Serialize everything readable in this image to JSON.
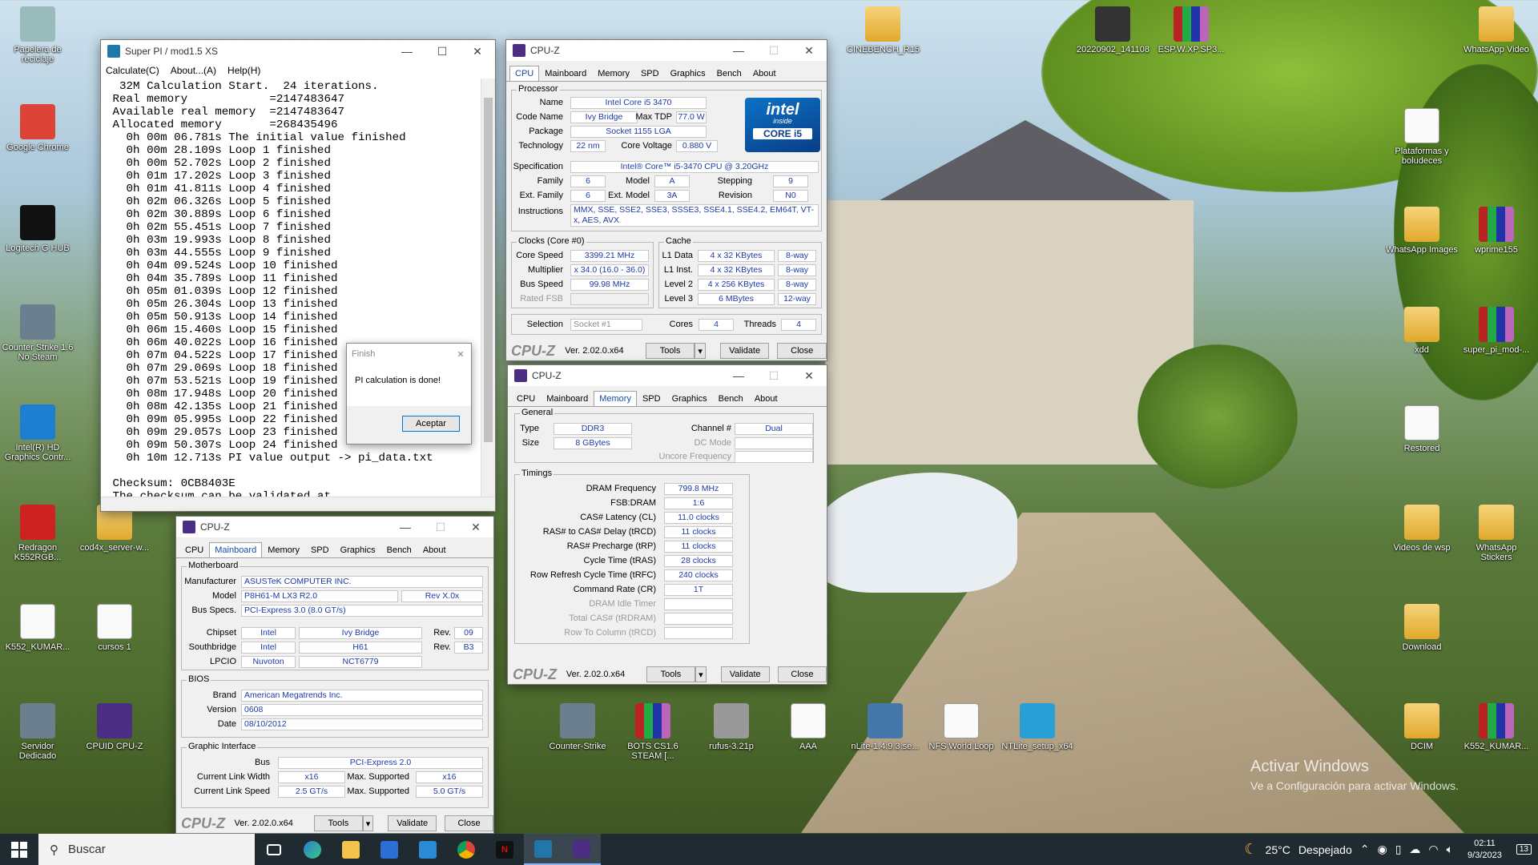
{
  "desktop": {
    "icons": [
      {
        "label": "Papelera de reciclaje",
        "kind": "app",
        "color": "#9bb"
      },
      {
        "label": "Google Chrome",
        "kind": "app",
        "color": "#db4437"
      },
      {
        "label": "Logitech G HUB",
        "kind": "app",
        "color": "#111"
      },
      {
        "label": "Counter Strike 1.6 No Steam",
        "kind": "app",
        "color": "#6b7f8e"
      },
      {
        "label": "Intel(R) HD Graphics Contr...",
        "kind": "app",
        "color": "#1e7fd0"
      },
      {
        "label": "Redragon K552RGB...",
        "kind": "app",
        "color": "#c22"
      },
      {
        "label": "K552_KUMAR...",
        "kind": "doc",
        "color": "#eee"
      },
      {
        "label": "Servidor Dedicado",
        "kind": "app",
        "color": "#6b7f8e"
      },
      {
        "label": "cod4x_server-w...",
        "kind": "folder",
        "color": ""
      },
      {
        "label": "cursos 1",
        "kind": "doc",
        "color": "#eee"
      },
      {
        "label": "CPUID CPU-Z",
        "kind": "app",
        "color": "#4b2e83"
      },
      {
        "label": "CINEBENCH_R15",
        "kind": "folder",
        "color": ""
      },
      {
        "label": "20220902_141108",
        "kind": "app",
        "color": "#333"
      },
      {
        "label": "ESP.W.XP.SP3...",
        "kind": "rar",
        "color": ""
      },
      {
        "label": "WhatsApp Video",
        "kind": "folder",
        "color": ""
      },
      {
        "label": "Plataformas y boludeces",
        "kind": "doc",
        "color": "#eee"
      },
      {
        "label": "WhatsApp Images",
        "kind": "folder",
        "color": ""
      },
      {
        "label": "wprime155",
        "kind": "rar",
        "color": ""
      },
      {
        "label": "xdd",
        "kind": "folder",
        "color": ""
      },
      {
        "label": "super_pi_mod-...",
        "kind": "rar",
        "color": ""
      },
      {
        "label": "Restored",
        "kind": "doc",
        "color": "#eee"
      },
      {
        "label": "Videos de wsp",
        "kind": "folder",
        "color": ""
      },
      {
        "label": "WhatsApp Stickers",
        "kind": "folder",
        "color": ""
      },
      {
        "label": "Download",
        "kind": "folder",
        "color": ""
      },
      {
        "label": "DCIM",
        "kind": "folder",
        "color": ""
      },
      {
        "label": "K552_KUMAR...",
        "kind": "rar",
        "color": ""
      },
      {
        "label": "Counter-Strike",
        "kind": "app",
        "color": "#6b7f8e"
      },
      {
        "label": "BOTS CS1.6 STEAM [...",
        "kind": "rar",
        "color": ""
      },
      {
        "label": "rufus-3.21p",
        "kind": "app",
        "color": "#999"
      },
      {
        "label": "AAA",
        "kind": "doc",
        "color": "#eee"
      },
      {
        "label": "nLite-1.4.9.3.se...",
        "kind": "app",
        "color": "#4477aa"
      },
      {
        "label": "NFS World Loop",
        "kind": "doc",
        "color": "#eee"
      },
      {
        "label": "NTLite_setup_x64",
        "kind": "app",
        "color": "#2a9fd6"
      }
    ],
    "watermark_title": "Activar Windows",
    "watermark_sub": "Ve a Configuración para activar Windows."
  },
  "superpi": {
    "title": "Super PI / mod1.5 XS",
    "menu": [
      "Calculate(C)",
      "About...(A)",
      "Help(H)"
    ],
    "lines": [
      "  32M Calculation Start.  24 iterations.",
      " Real memory            =2147483647",
      " Available real memory  =2147483647",
      " Allocated memory       =268435496",
      "   0h 00m 06.781s The initial value finished",
      "   0h 00m 28.109s Loop 1 finished",
      "   0h 00m 52.702s Loop 2 finished",
      "   0h 01m 17.202s Loop 3 finished",
      "   0h 01m 41.811s Loop 4 finished",
      "   0h 02m 06.326s Loop 5 finished",
      "   0h 02m 30.889s Loop 6 finished",
      "   0h 02m 55.451s Loop 7 finished",
      "   0h 03m 19.993s Loop 8 finished",
      "   0h 03m 44.555s Loop 9 finished",
      "   0h 04m 09.524s Loop 10 finished",
      "   0h 04m 35.789s Loop 11 finished",
      "   0h 05m 01.039s Loop 12 finished",
      "   0h 05m 26.304s Loop 13 finished",
      "   0h 05m 50.913s Loop 14 finished",
      "   0h 06m 15.460s Loop 15 finished",
      "   0h 06m 40.022s Loop 16 finished",
      "   0h 07m 04.522s Loop 17 finished",
      "   0h 07m 29.069s Loop 18 finished",
      "   0h 07m 53.521s Loop 19 finished",
      "   0h 08m 17.948s Loop 20 finished",
      "   0h 08m 42.135s Loop 21 finished",
      "   0h 09m 05.995s Loop 22 finished",
      "   0h 09m 29.057s Loop 23 finished",
      "   0h 09m 50.307s Loop 24 finished",
      "   0h 10m 12.713s PI value output -> pi_data.txt",
      "",
      " Checksum: 0CB8403E",
      " The checksum can be validated at"
    ]
  },
  "finish_dialog": {
    "title": "Finish",
    "message": "PI calculation is done!",
    "button": "Aceptar"
  },
  "cpuz_tabs": [
    "CPU",
    "Mainboard",
    "Memory",
    "SPD",
    "Graphics",
    "Bench",
    "About"
  ],
  "cpuz_common": {
    "title": "CPU-Z",
    "logo": "CPU-Z",
    "version": "Ver. 2.02.0.x64",
    "tools": "Tools",
    "validate": "Validate",
    "close": "Close"
  },
  "cpuz_cpu": {
    "processor_label": "Processor",
    "name_label": "Name",
    "name": "Intel Core i5 3470",
    "codename_label": "Code Name",
    "codename": "Ivy Bridge",
    "tdp_label": "Max TDP",
    "tdp": "77.0 W",
    "package_label": "Package",
    "package": "Socket 1155 LGA",
    "tech_label": "Technology",
    "tech": "22 nm",
    "voltage_label": "Core Voltage",
    "voltage": "0.880 V",
    "spec_label": "Specification",
    "spec": "Intel® Core™ i5-3470 CPU @ 3.20GHz",
    "family_label": "Family",
    "family": "6",
    "model_label": "Model",
    "model": "A",
    "stepping_label": "Stepping",
    "stepping": "9",
    "extfamily_label": "Ext. Family",
    "extfamily": "6",
    "extmodel_label": "Ext. Model",
    "extmodel": "3A",
    "revision_label": "Revision",
    "revision": "N0",
    "instr_label": "Instructions",
    "instr": "MMX, SSE, SSE2, SSE3, SSSE3, SSE4.1, SSE4.2, EM64T, VT-x, AES, AVX",
    "clocks_label": "Clocks (Core #0)",
    "corespeed_label": "Core Speed",
    "corespeed": "3399.21 MHz",
    "mult_label": "Multiplier",
    "mult": "x 34.0 (16.0 - 36.0)",
    "bus_label": "Bus Speed",
    "bus": "99.98 MHz",
    "fsb_label": "Rated FSB",
    "fsb": "",
    "cache_label": "Cache",
    "l1d_label": "L1 Data",
    "l1d": "4 x 32 KBytes",
    "l1d_way": "8-way",
    "l1i_label": "L1 Inst.",
    "l1i": "4 x 32 KBytes",
    "l1i_way": "8-way",
    "l2_label": "Level 2",
    "l2": "4 x 256 KBytes",
    "l2_way": "8-way",
    "l3_label": "Level 3",
    "l3": "6 MBytes",
    "l3_way": "12-way",
    "selection_label": "Selection",
    "selection": "Socket #1",
    "cores_label": "Cores",
    "cores": "4",
    "threads_label": "Threads",
    "threads": "4",
    "intel_brand": "intel",
    "intel_inside": "inside",
    "intel_core": "CORE i5"
  },
  "cpuz_mem": {
    "general_label": "General",
    "type_label": "Type",
    "type": "DDR3",
    "size_label": "Size",
    "size": "8 GBytes",
    "channel_label": "Channel #",
    "channel": "Dual",
    "dcmode_label": "DC Mode",
    "dcmode": "",
    "uncore_label": "Uncore Frequency",
    "uncore": "",
    "timings_label": "Timings",
    "rows": [
      {
        "label": "DRAM Frequency",
        "value": "799.8 MHz",
        "dim": false
      },
      {
        "label": "FSB:DRAM",
        "value": "1:6",
        "dim": false
      },
      {
        "label": "CAS# Latency (CL)",
        "value": "11.0 clocks",
        "dim": false
      },
      {
        "label": "RAS# to CAS# Delay (tRCD)",
        "value": "11 clocks",
        "dim": false
      },
      {
        "label": "RAS# Precharge (tRP)",
        "value": "11 clocks",
        "dim": false
      },
      {
        "label": "Cycle Time (tRAS)",
        "value": "28 clocks",
        "dim": false
      },
      {
        "label": "Row Refresh Cycle Time (tRFC)",
        "value": "240 clocks",
        "dim": false
      },
      {
        "label": "Command Rate (CR)",
        "value": "1T",
        "dim": false
      },
      {
        "label": "DRAM Idle Timer",
        "value": "",
        "dim": true
      },
      {
        "label": "Total CAS# (tRDRAM)",
        "value": "",
        "dim": true
      },
      {
        "label": "Row To Column (tRCD)",
        "value": "",
        "dim": true
      }
    ]
  },
  "cpuz_mb": {
    "mb_label": "Motherboard",
    "manu_label": "Manufacturer",
    "manu": "ASUSTeK COMPUTER INC.",
    "model_label": "Model",
    "model": "P8H61-M LX3 R2.0",
    "rev": "Rev X.0x",
    "busspecs_label": "Bus Specs.",
    "busspecs": "PCI-Express 3.0 (8.0 GT/s)",
    "chipset_label": "Chipset",
    "chipset_v": "Intel",
    "chipset_n": "Ivy Bridge",
    "chipset_rev_label": "Rev.",
    "chipset_rev": "09",
    "south_label": "Southbridge",
    "south_v": "Intel",
    "south_n": "H61",
    "south_rev_label": "Rev.",
    "south_rev": "B3",
    "lpcio_label": "LPCIO",
    "lpcio_v": "Nuvoton",
    "lpcio_n": "NCT6779",
    "bios_label": "BIOS",
    "brand_label": "Brand",
    "brand": "American Megatrends Inc.",
    "version_label": "Version",
    "version": "0608",
    "date_label": "Date",
    "date": "08/10/2012",
    "gi_label": "Graphic Interface",
    "gbus_label": "Bus",
    "gbus": "PCI-Express 2.0",
    "clw_label": "Current Link Width",
    "clw": "x16",
    "mslw_label": "Max. Supported",
    "mslw": "x16",
    "cls_label": "Current Link Speed",
    "cls": "2.5 GT/s",
    "msls_label": "Max. Supported",
    "msls": "5.0 GT/s"
  },
  "taskbar": {
    "search": "Buscar",
    "weather_temp": "25°C",
    "weather_text": "Despejado",
    "time": "02:11",
    "date": "9/3/2023",
    "notif": "13"
  }
}
